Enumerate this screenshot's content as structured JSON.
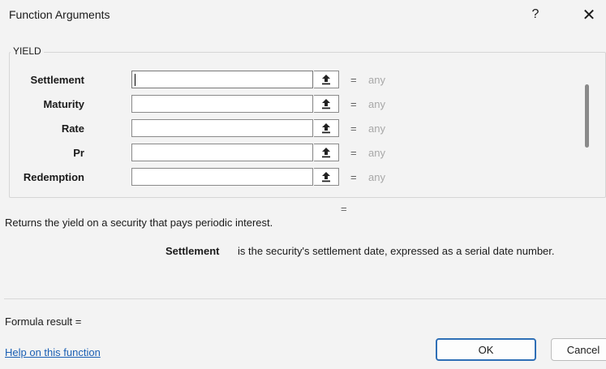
{
  "dialog": {
    "title": "Function Arguments",
    "help_button": "?",
    "close_button": "✕"
  },
  "function_name": "YIELD",
  "arguments": [
    {
      "label": "Settlement",
      "value": "",
      "result_eq": "=",
      "result": "any"
    },
    {
      "label": "Maturity",
      "value": "",
      "result_eq": "=",
      "result": "any"
    },
    {
      "label": "Rate",
      "value": "",
      "result_eq": "=",
      "result": "any"
    },
    {
      "label": "Pr",
      "value": "",
      "result_eq": "=",
      "result": "any"
    },
    {
      "label": "Redemption",
      "value": "",
      "result_eq": "=",
      "result": "any"
    }
  ],
  "function_result_eq": "=",
  "description": "Returns the yield on a security that pays periodic interest.",
  "argument_help": {
    "name": "Settlement",
    "text": "is the security's settlement date, expressed as a serial date number."
  },
  "formula_result": "Formula result =",
  "help_link": "Help on this function",
  "buttons": {
    "ok": "OK",
    "cancel": "Cancel"
  },
  "colors": {
    "accent": "#2f6fb6",
    "link": "#1a5fb4"
  }
}
